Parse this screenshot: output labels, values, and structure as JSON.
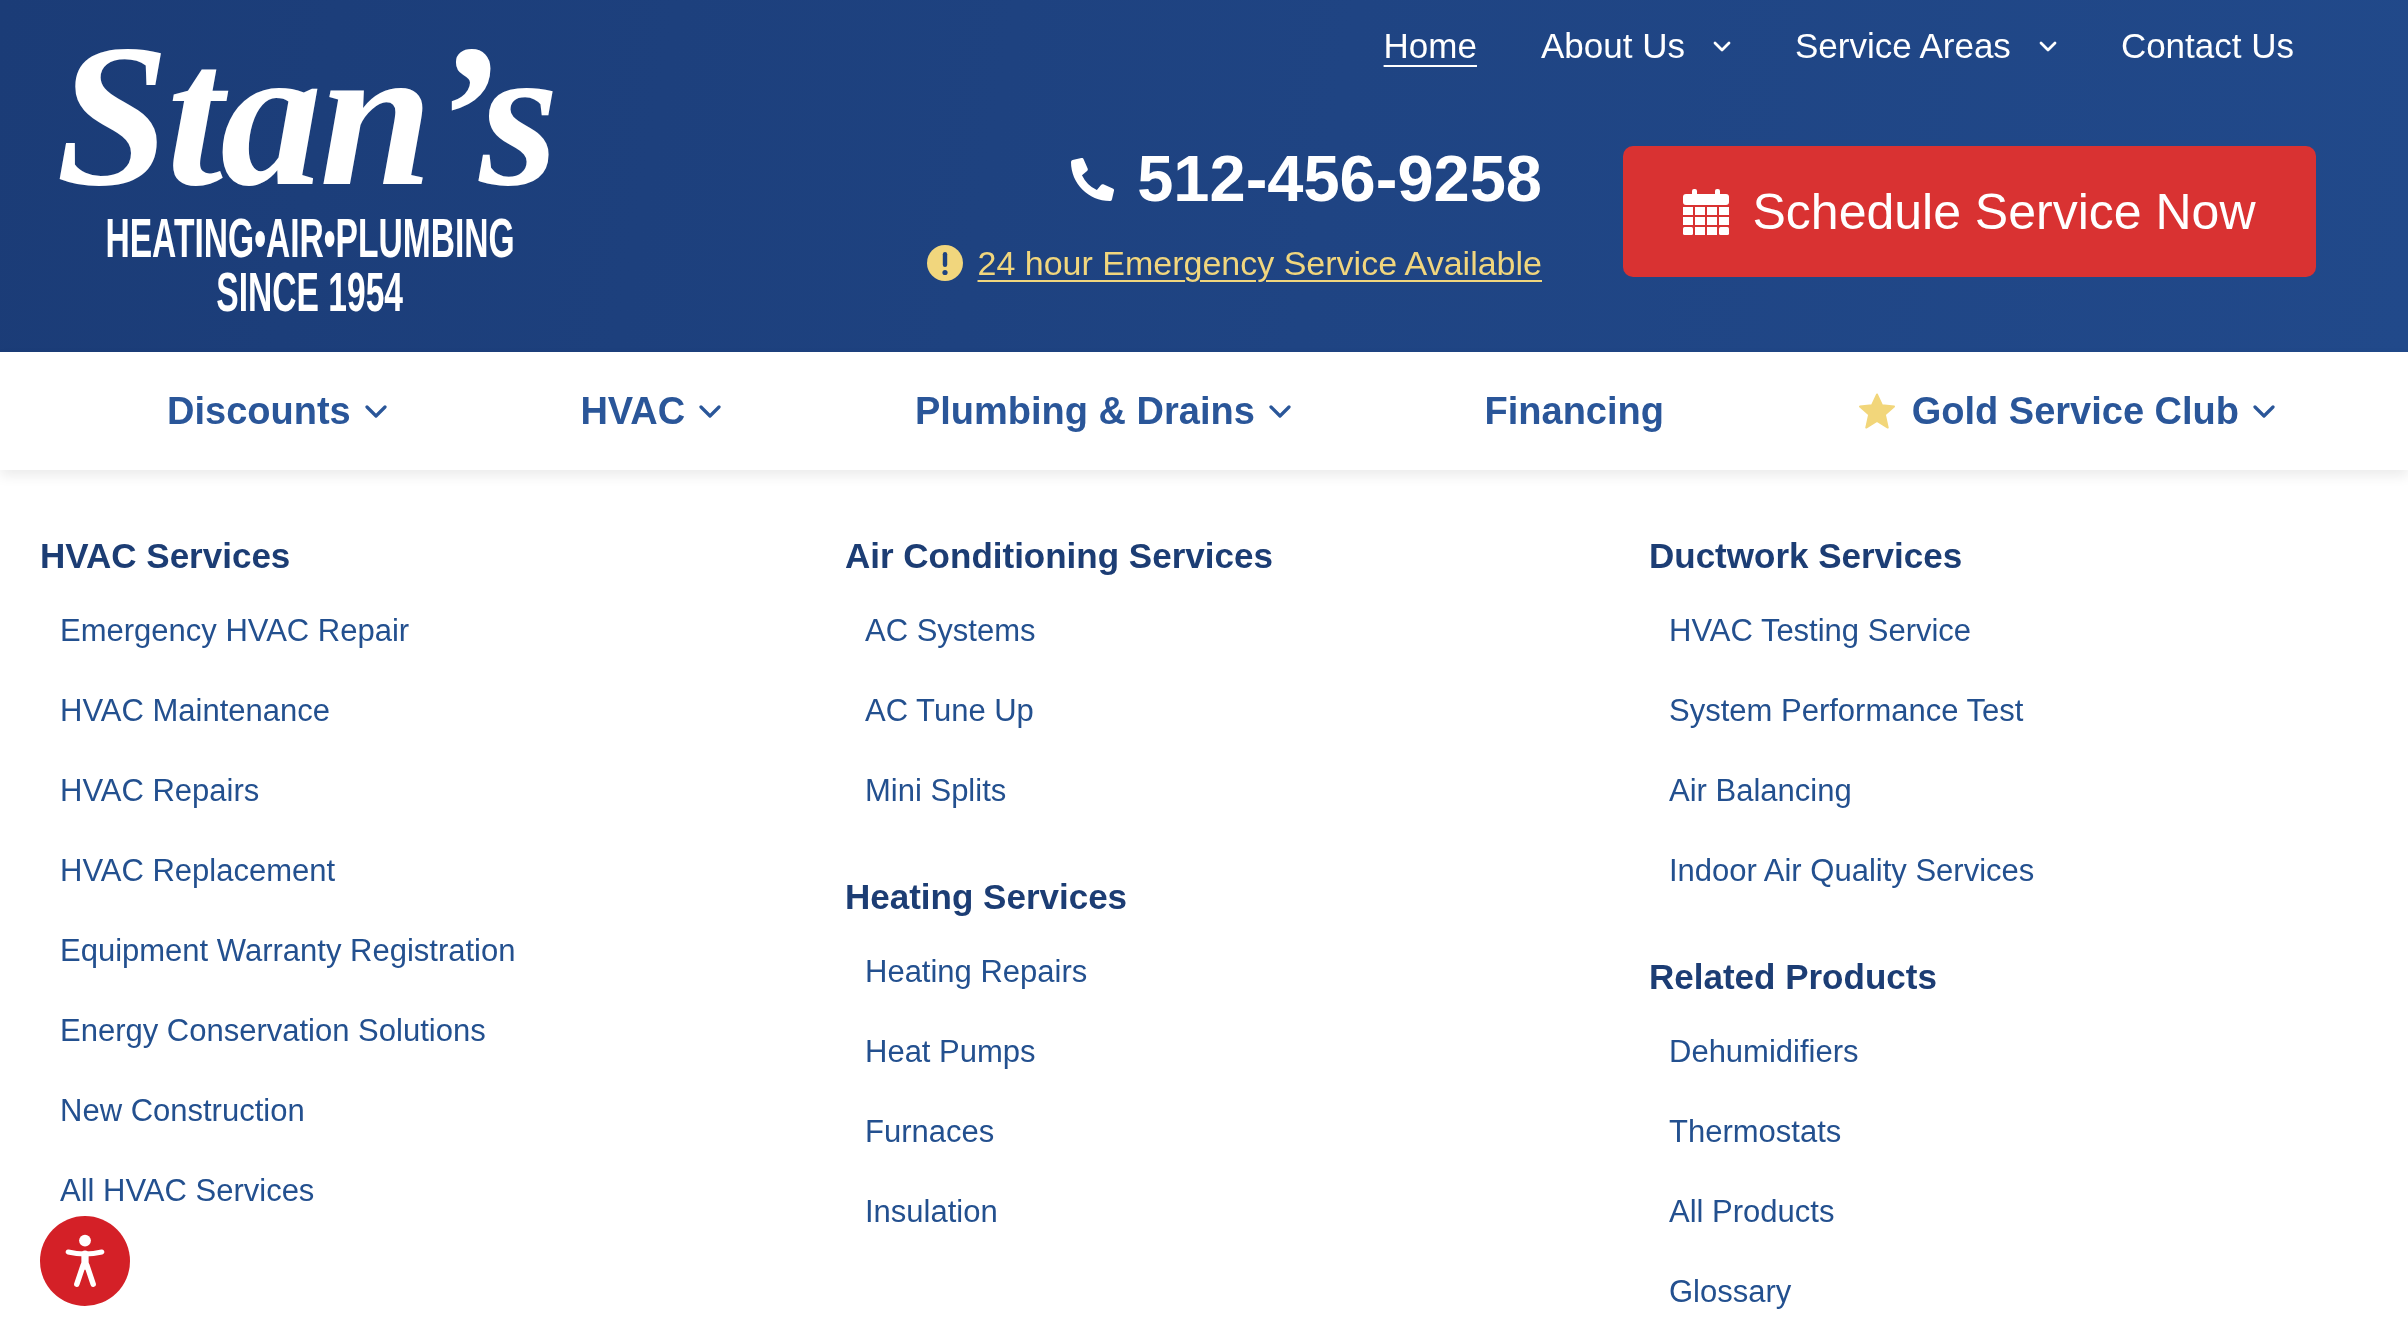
{
  "logo": {
    "wordmark": "Stan’s",
    "tagline": "HEATING•AIR•PLUMBING",
    "since": "SINCE 1954"
  },
  "top_nav": [
    {
      "label": "Home",
      "selected": true,
      "has_dropdown": false
    },
    {
      "label": "About Us",
      "selected": false,
      "has_dropdown": true
    },
    {
      "label": "Service Areas",
      "selected": false,
      "has_dropdown": true
    },
    {
      "label": "Contact Us",
      "selected": false,
      "has_dropdown": false
    }
  ],
  "phone": "512-456-9258",
  "emergency_link": "24 hour Emergency Service Available",
  "schedule_button": "Schedule Service Now",
  "main_nav": [
    {
      "label": "Discounts",
      "has_dropdown": true,
      "starred": false
    },
    {
      "label": "HVAC",
      "has_dropdown": true,
      "starred": false
    },
    {
      "label": "Plumbing & Drains",
      "has_dropdown": true,
      "starred": false
    },
    {
      "label": "Financing",
      "has_dropdown": false,
      "starred": false
    },
    {
      "label": "Gold Service Club",
      "has_dropdown": true,
      "starred": true
    }
  ],
  "mega_menu": [
    {
      "groups": [
        {
          "heading": "HVAC Services",
          "items": [
            "Emergency HVAC Repair",
            "HVAC Maintenance",
            "HVAC Repairs",
            "HVAC Replacement",
            "Equipment Warranty Registration",
            "Energy Conservation Solutions",
            "New Construction",
            "All HVAC Services"
          ]
        }
      ]
    },
    {
      "groups": [
        {
          "heading": "Air Conditioning Services",
          "items": [
            "AC Systems",
            "AC Tune Up",
            "Mini Splits"
          ]
        },
        {
          "heading": "Heating Services",
          "items": [
            "Heating Repairs",
            "Heat Pumps",
            "Furnaces",
            "Insulation"
          ]
        }
      ]
    },
    {
      "groups": [
        {
          "heading": "Ductwork Services",
          "items": [
            "HVAC Testing Service",
            "System Performance Test",
            "Air Balancing",
            "Indoor Air Quality Services"
          ]
        },
        {
          "heading": "Related Products",
          "items": [
            "Dehumidifiers",
            "Thermostats",
            "All Products",
            "Glossary"
          ]
        }
      ]
    }
  ]
}
